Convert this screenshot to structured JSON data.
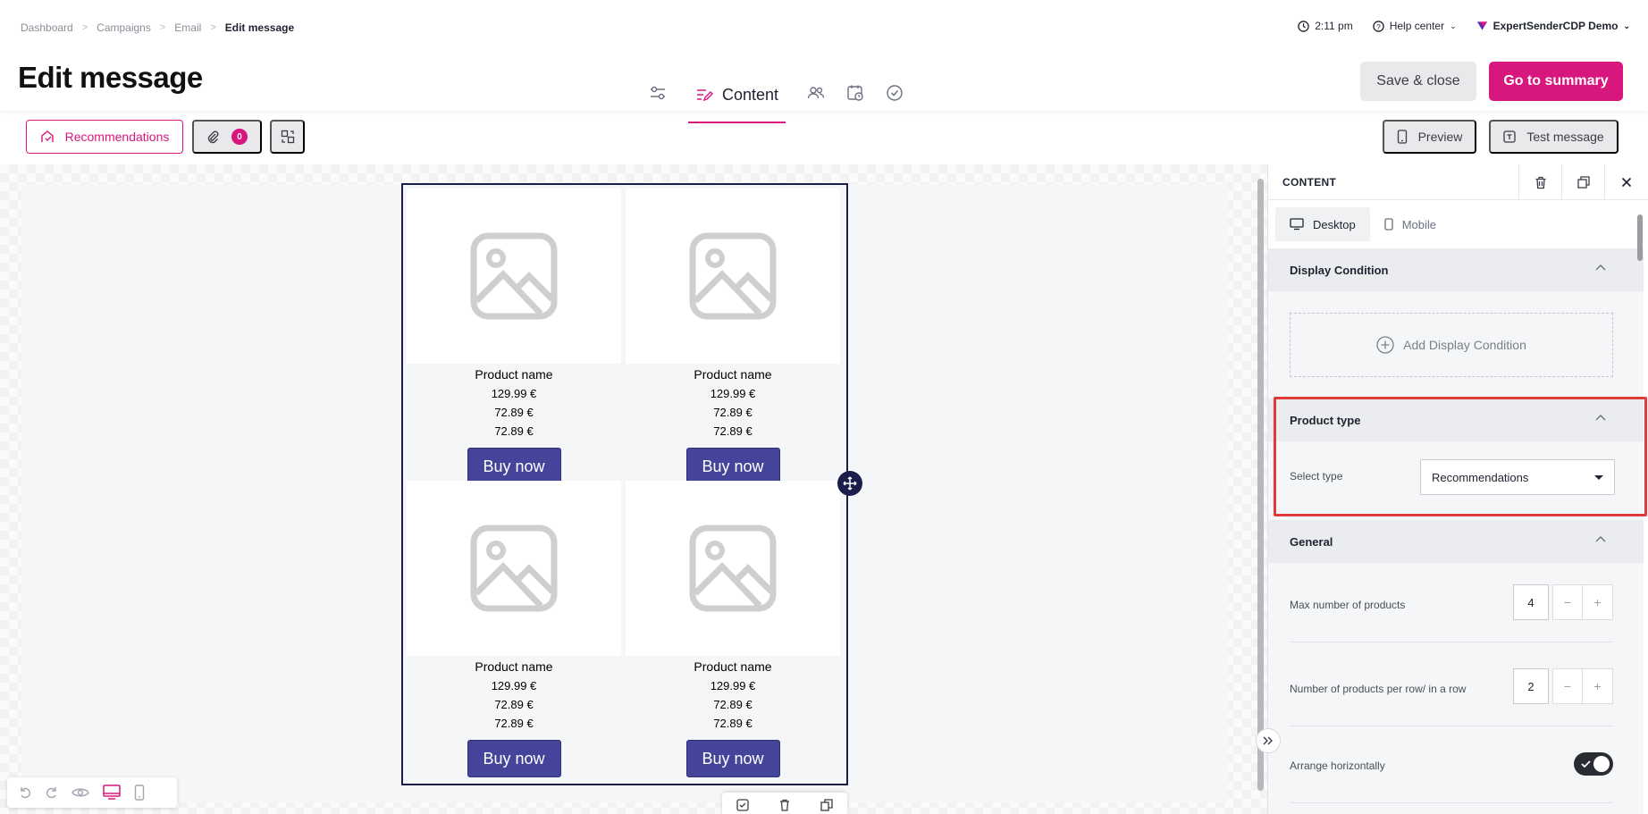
{
  "breadcrumb": {
    "items": [
      "Dashboard",
      "Campaigns",
      "Email"
    ],
    "current": "Edit message"
  },
  "header": {
    "time": "2:11 pm",
    "help": "Help center",
    "account": "ExpertSenderCDP Demo",
    "title": "Edit message",
    "active_step": "Content",
    "save_close": "Save & close",
    "go_summary": "Go to summary"
  },
  "toolbar": {
    "recommendations": "Recommendations",
    "attachments_count": "0",
    "preview": "Preview",
    "test_message": "Test message"
  },
  "products": [
    {
      "name": "Product name",
      "price1": "129.99 €",
      "price2": "72.89 €",
      "price3": "72.89 €",
      "button": "Buy now"
    },
    {
      "name": "Product name",
      "price1": "129.99 €",
      "price2": "72.89 €",
      "price3": "72.89 €",
      "button": "Buy now"
    },
    {
      "name": "Product name",
      "price1": "129.99 €",
      "price2": "72.89 €",
      "price3": "72.89 €",
      "button": "Buy now"
    },
    {
      "name": "Product name",
      "price1": "129.99 €",
      "price2": "72.89 €",
      "price3": "72.89 €",
      "button": "Buy now"
    }
  ],
  "panel": {
    "title": "CONTENT",
    "tabs": [
      "Desktop",
      "Mobile"
    ],
    "display_condition": {
      "title": "Display Condition",
      "add_label": "Add Display Condition"
    },
    "product_type": {
      "title": "Product type",
      "select_label": "Select type",
      "selected": "Recommendations"
    },
    "general": {
      "title": "General",
      "max_products_label": "Max number of products",
      "max_products_value": "4",
      "per_row_label": "Number of products per row/ in a row",
      "per_row_value": "2",
      "arrange_label": "Arrange horizontally",
      "arrange_on": true
    }
  },
  "colors": {
    "accent": "#d8177e",
    "button": "#44459a",
    "highlight": "#e03a3a"
  }
}
